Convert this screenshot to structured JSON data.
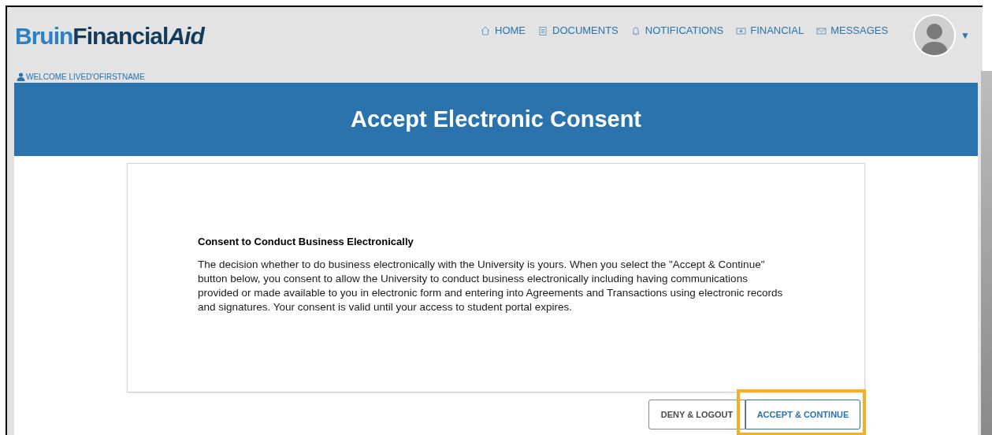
{
  "logo": {
    "parts": [
      {
        "text": "Bruin",
        "kind": "light"
      },
      {
        "text": "Financial",
        "kind": "dark"
      },
      {
        "text": "Aid",
        "kind": "italic"
      }
    ]
  },
  "nav": [
    {
      "label": "HOME",
      "kind": "home"
    },
    {
      "label": "DOCUMENTS",
      "kind": "documents"
    },
    {
      "label": "NOTIFICATIONS",
      "kind": "bell"
    },
    {
      "label": "FINANCIAL",
      "kind": "money"
    },
    {
      "label": "MESSAGES",
      "kind": "mail"
    }
  ],
  "menu_caret": "▼",
  "welcome": "WELCOME LIVED'OFIRSTNAME",
  "banner_title": "Accept Electronic Consent",
  "consent": {
    "heading": "Consent to Conduct Business Electronically",
    "body": "The decision whether to do business electronically with the University is yours. When you select the \"Accept & Continue\" button below, you consent to allow the University to conduct business electronically including having communications provided or made available to you in electronic form and entering into Agreements and Transactions using electronic records and signatures. Your consent is valid until your access to student portal expires."
  },
  "buttons": [
    {
      "label": "DENY & LOGOUT",
      "kind": "secondary",
      "highlighted": false
    },
    {
      "label": "ACCEPT & CONTINUE",
      "kind": "primary",
      "highlighted": true
    }
  ]
}
